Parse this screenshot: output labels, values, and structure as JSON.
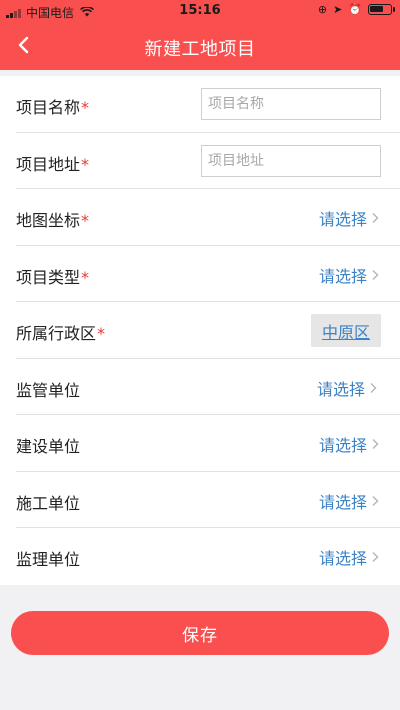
{
  "status_bar": {
    "carrier": "中国电信",
    "time": "15:16",
    "battery_level": 0.7
  },
  "nav": {
    "title": "新建工地项目",
    "back_icon": "chevron-left-icon"
  },
  "form": {
    "project_name": {
      "label": "项目名称",
      "required": "*",
      "placeholder": "项目名称",
      "value": ""
    },
    "project_address": {
      "label": "项目地址",
      "required": "*",
      "placeholder": "项目地址",
      "value": ""
    },
    "map_coordinates": {
      "label": "地图坐标",
      "required": "*",
      "value": "请选择"
    },
    "project_type": {
      "label": "项目类型",
      "required": "*",
      "value": "请选择"
    },
    "district": {
      "label": "所属行政区",
      "required": "*",
      "value": "中原区"
    },
    "supervising_unit": {
      "label": "监管单位",
      "value": "请选择"
    },
    "construction_unit": {
      "label": "建设单位",
      "value": "请选择"
    },
    "building_unit": {
      "label": "施工单位",
      "value": "请选择"
    },
    "supervision_unit": {
      "label": "监理单位",
      "value": "请选择"
    }
  },
  "actions": {
    "save_label": "保存"
  },
  "colors": {
    "accent": "#f94f4f",
    "link": "#3d82c4",
    "required": "#e53935"
  }
}
